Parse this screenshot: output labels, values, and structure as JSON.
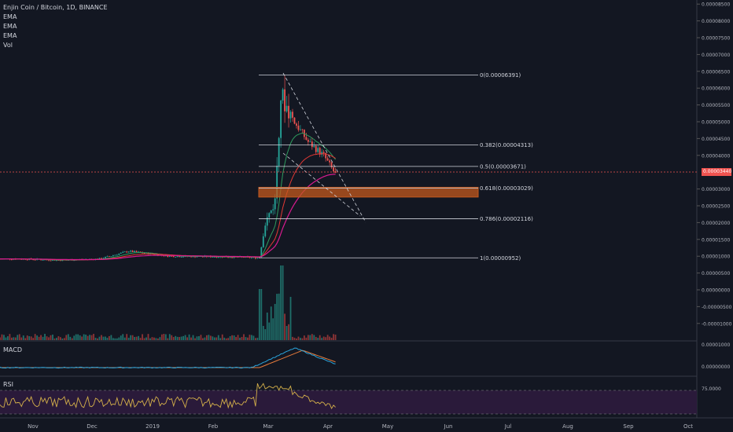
{
  "header": {
    "title": "Enjin Coin / Bitcoin, 1D, BINANCE",
    "indicators": [
      "EMA",
      "EMA",
      "EMA",
      "Vol"
    ]
  },
  "macd_label": "MACD",
  "rsi_label": "RSI",
  "current_price": "0.00003440",
  "colors": {
    "background": "#131722",
    "up": "#26a69a",
    "down": "#ef5350",
    "ema_fast": "#2e9c5e",
    "ema_mid": "#e53935",
    "ema_slow": "#d81b8f",
    "fib_line": "#d1d4dc",
    "zone": "#c4591e",
    "rsi_line": "#d4b04a",
    "rsi_band": "#2a1a3a"
  },
  "chart_data": {
    "type": "candlestick",
    "x_tick_labels": [
      "Nov",
      "Dec",
      "2019",
      "Feb",
      "Mar",
      "Apr",
      "May",
      "Jun",
      "Jul",
      "Aug",
      "Sep",
      "Oct"
    ],
    "price_axis": {
      "labels": [
        "0.00008500",
        "0.00008000",
        "0.00007500",
        "0.00007000",
        "0.00006500",
        "0.00006000",
        "0.00005500",
        "0.00005000",
        "0.00004500",
        "0.00004000",
        "0.00003000",
        "0.00002500",
        "0.00002000",
        "0.00001500",
        "0.00001000",
        "0.00000500",
        "0.00000000",
        "-0.00000500",
        "-0.00001000",
        "-0.00001500"
      ],
      "ylim": [
        -1.5e-05,
        8.5e-05
      ]
    },
    "fib_levels": [
      {
        "label": "0(0.00006391)",
        "value": 6.391e-05
      },
      {
        "label": "0.382(0.00004313)",
        "value": 4.313e-05
      },
      {
        "label": "0.5(0.00003671)",
        "value": 3.671e-05
      },
      {
        "label": "0.618(0.00003029)",
        "value": 3.029e-05
      },
      {
        "label": "0.786(0.00002116)",
        "value": 2.116e-05
      },
      {
        "label": "1(0.00000952)",
        "value": 9.52e-06
      }
    ],
    "zone": {
      "low": 2.76e-05,
      "high": 3.05e-05
    },
    "approx_close_path": [
      {
        "date": "2018-10-25",
        "close": 9.2e-06
      },
      {
        "date": "2018-11-15",
        "close": 8.8e-06
      },
      {
        "date": "2018-12-05",
        "close": 9.2e-06
      },
      {
        "date": "2018-12-20",
        "close": 1.15e-05
      },
      {
        "date": "2019-01-10",
        "close": 1e-05
      },
      {
        "date": "2019-02-10",
        "close": 9.8e-06
      },
      {
        "date": "2019-02-25",
        "close": 9.5e-06
      },
      {
        "date": "2019-02-28",
        "close": 2e-05
      },
      {
        "date": "2019-03-05",
        "close": 2.6e-05
      },
      {
        "date": "2019-03-08",
        "close": 5.8e-05
      },
      {
        "date": "2019-03-15",
        "close": 5e-05
      },
      {
        "date": "2019-03-22",
        "close": 4.4e-05
      },
      {
        "date": "2019-03-30",
        "close": 4e-05
      },
      {
        "date": "2019-04-05",
        "close": 3.44e-05
      }
    ],
    "macd_axis": {
      "labels": [
        "0.00001000",
        "0.00000000"
      ]
    },
    "rsi_axis": {
      "labels": [
        "75.0000"
      ]
    }
  }
}
